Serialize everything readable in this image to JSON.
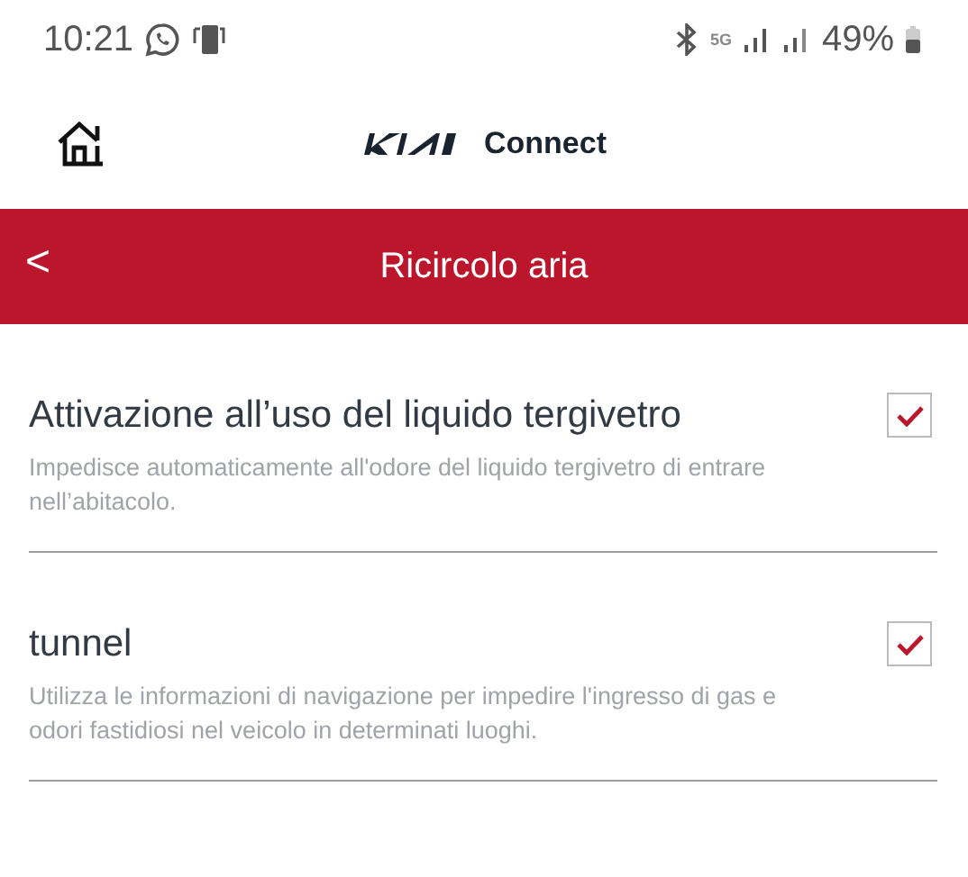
{
  "status_bar": {
    "time": "10:21",
    "network": "5G",
    "battery": "49%"
  },
  "header": {
    "brand": "Connect"
  },
  "title_bar": {
    "back": "<",
    "title": "Ricircolo aria"
  },
  "settings": [
    {
      "title": "Attivazione all’uso del liquido tergivetro",
      "description": "Impedisce automaticamente all'odore del liquido tergivetro di entrare nell’abitacolo.",
      "checked": true
    },
    {
      "title": "tunnel",
      "description": "Utilizza le informazioni di navigazione per impedire l'ingresso di gas e odori fastidiosi nel veicolo in determinati luoghi.",
      "checked": true
    }
  ]
}
